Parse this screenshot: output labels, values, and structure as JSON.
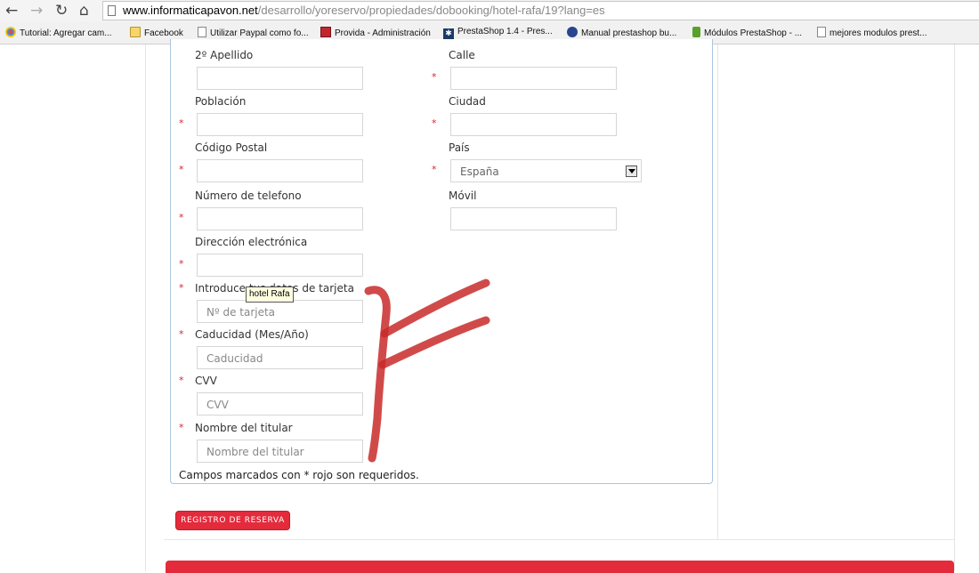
{
  "browser": {
    "url_host": "www.informaticapavon.net",
    "url_path": "/desarrollo/yoreservo/propiedades/dobooking/hotel-rafa/19?lang=es",
    "bookmarks": [
      "Tutorial: Agregar cam...",
      "Facebook",
      "Utilizar Paypal como fo...",
      "Provida - Administración",
      "PrestaShop 1.4 - Pres...",
      "Manual prestashop bu...",
      "Módulos PrestaShop - ...",
      "mejores modulos prest..."
    ]
  },
  "form": {
    "required_mark": "*",
    "segundo_apellido_label": "2º Apellido",
    "calle_label": "Calle",
    "poblacion_label": "Población",
    "ciudad_label": "Ciudad",
    "codigo_postal_label": "Código Postal",
    "pais_label": "País",
    "pais_value": "España",
    "telefono_label": "Número de telefono",
    "movil_label": "Móvil",
    "email_label": "Dirección electrónica",
    "tarjeta_label": "Introduce tus datos de tarjeta",
    "tarjeta_placeholder": "Nº de tarjeta",
    "caducidad_label": "Caducidad (Mes/Año)",
    "caducidad_placeholder": "Caducidad",
    "cvv_label": "CVV",
    "cvv_placeholder": "CVV",
    "titular_label": "Nombre del titular",
    "titular_placeholder": "Nombre del titular",
    "note": "Campos marcados con * rojo son requeridos."
  },
  "tooltip": "hotel Rafa",
  "submit_label": "REGISTRO DE RESERVA",
  "colors": {
    "accent_red": "#e32b3c",
    "required_red": "#d9252f",
    "panel_border": "#a9c6df"
  }
}
